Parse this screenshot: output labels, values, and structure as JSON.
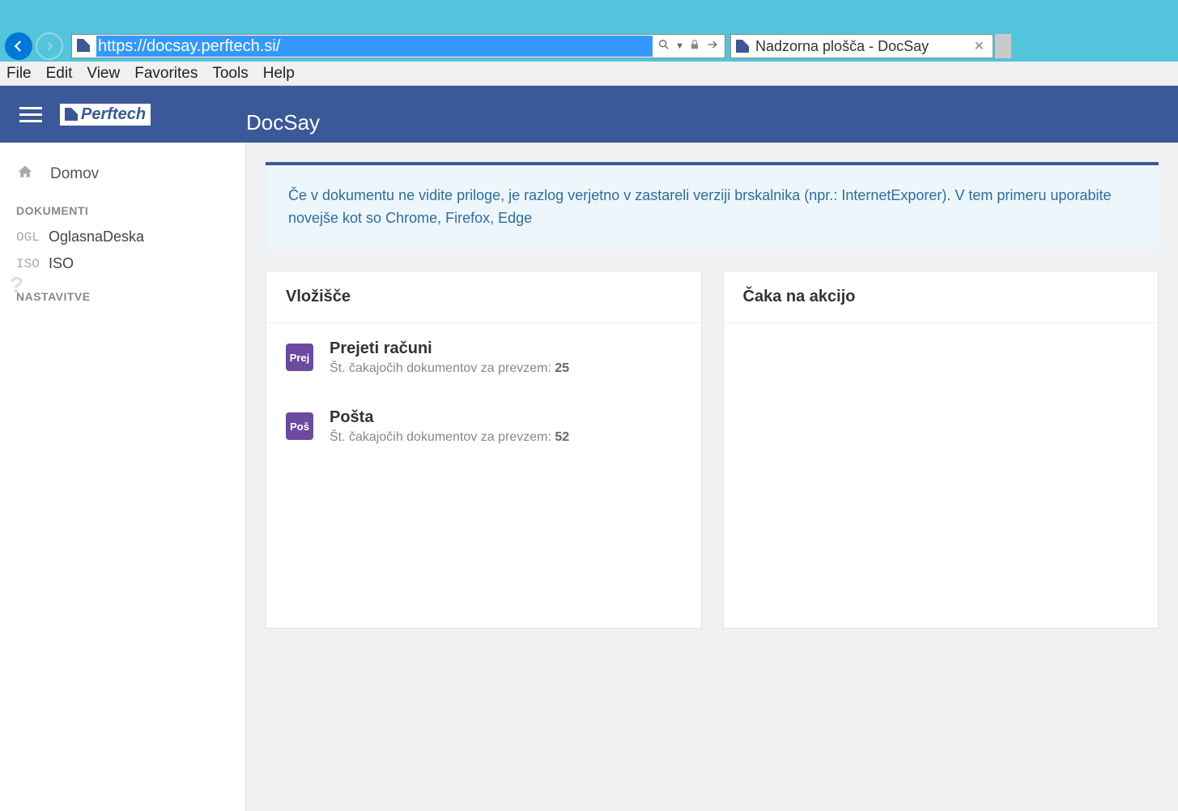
{
  "browser": {
    "url": "https://docsay.perftech.si/",
    "tab_title": "Nadzorna plošča - DocSay",
    "menu": [
      "File",
      "Edit",
      "View",
      "Favorites",
      "Tools",
      "Help"
    ]
  },
  "app": {
    "logo_text": "Perftech",
    "header_title": "DocSay"
  },
  "sidebar": {
    "home": "Domov",
    "section_documents": "DOKUMENTI",
    "items": [
      {
        "tag": "OGL",
        "label": "OglasnaDeska"
      },
      {
        "tag": "ISO",
        "label": "ISO"
      }
    ],
    "section_settings": "NASTAVITVE"
  },
  "alert": {
    "text": "Če v dokumentu ne vidite priloge, je razlog verjetno v zastareli verziji brskalnika (npr.: InternetExporer). V tem primeru uporabite novejše kot so Chrome, Firefox, Edge"
  },
  "inbox": {
    "title": "Vložišče",
    "waiting_label": "Št. čakajočih dokumentov za prevzem:",
    "items": [
      {
        "icon": "Prej",
        "title": "Prejeti računi",
        "count": "25"
      },
      {
        "icon": "Poš",
        "title": "Pošta",
        "count": "52"
      }
    ]
  },
  "actions": {
    "title": "Čaka na akcijo"
  }
}
